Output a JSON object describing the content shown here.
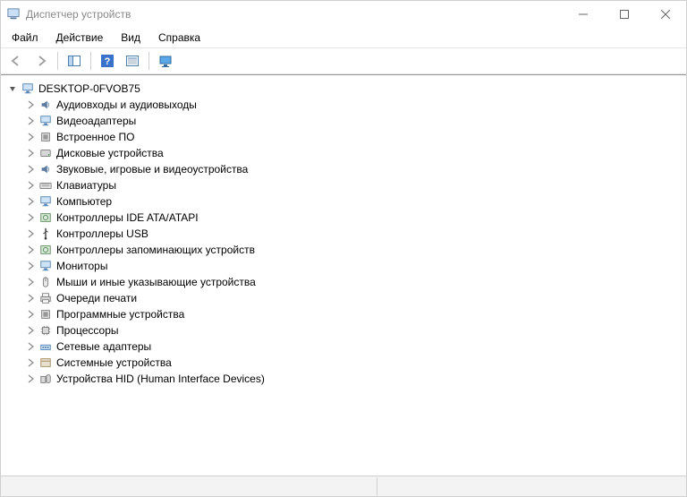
{
  "window": {
    "title": "Диспетчер устройств"
  },
  "menubar": {
    "file": "Файл",
    "action": "Действие",
    "view": "Вид",
    "help": "Справка"
  },
  "tree": {
    "root": "DESKTOP-0FVOB75",
    "nodes": [
      {
        "icon": "audio",
        "label": "Аудиовходы и аудиовыходы"
      },
      {
        "icon": "display",
        "label": "Видеоадаптеры"
      },
      {
        "icon": "firmware",
        "label": "Встроенное ПО"
      },
      {
        "icon": "disk",
        "label": "Дисковые устройства"
      },
      {
        "icon": "sound",
        "label": "Звуковые, игровые и видеоустройства"
      },
      {
        "icon": "keyboard",
        "label": "Клавиатуры"
      },
      {
        "icon": "computer",
        "label": "Компьютер"
      },
      {
        "icon": "ide",
        "label": "Контроллеры IDE ATA/ATAPI"
      },
      {
        "icon": "usb",
        "label": "Контроллеры USB"
      },
      {
        "icon": "storage",
        "label": "Контроллеры запоминающих устройств"
      },
      {
        "icon": "monitor",
        "label": "Мониторы"
      },
      {
        "icon": "mouse",
        "label": "Мыши и иные указывающие устройства"
      },
      {
        "icon": "printer",
        "label": "Очереди печати"
      },
      {
        "icon": "software",
        "label": "Программные устройства"
      },
      {
        "icon": "cpu",
        "label": "Процессоры"
      },
      {
        "icon": "network",
        "label": "Сетевые адаптеры"
      },
      {
        "icon": "system",
        "label": "Системные устройства"
      },
      {
        "icon": "hid",
        "label": "Устройства HID (Human Interface Devices)"
      }
    ]
  }
}
